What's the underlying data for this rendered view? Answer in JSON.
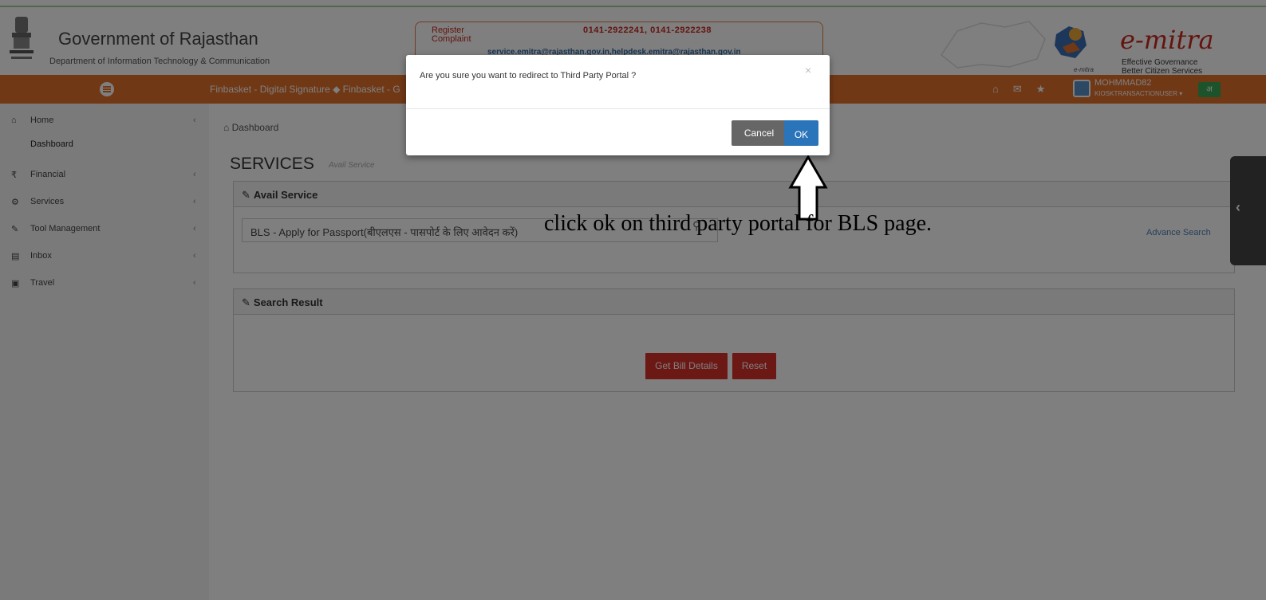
{
  "header": {
    "gov_title": "Government of Rajasthan",
    "dept_title": "Department of Information Technology & Communication",
    "register_complaint": "Register Complaint",
    "phones": "0141-2922241, 0141-2922238",
    "emails": "service.emitra@rajasthan.gov.in,helpdesk.emitra@rajasthan.gov.in",
    "brand": "e-mitra",
    "brand_small": "e-mitra",
    "tagline_1": "Effective Governance",
    "tagline_2": "Better Citizen Services"
  },
  "navbar": {
    "ticker": "Finbasket - Digital Signature ◆ Finbasket - G",
    "user_name": "MOHMMAD82",
    "user_role": "KIOSKTRANSACTIONUSER ▾",
    "lang": "अ"
  },
  "sidebar": {
    "items": [
      {
        "icon": "⌂",
        "label": "Home"
      },
      {
        "icon": "₹",
        "label": "Financial"
      },
      {
        "icon": "⚙",
        "label": "Services"
      },
      {
        "icon": "✎",
        "label": "Tool Management"
      },
      {
        "icon": "▤",
        "label": "Inbox"
      },
      {
        "icon": "▣",
        "label": "Travel"
      }
    ],
    "sub_dashboard": "Dashboard"
  },
  "main": {
    "breadcrumb": "Dashboard",
    "title": "SERVICES",
    "subtitle": "Avail Service",
    "avail_panel_title": "Avail Service",
    "service_value": "BLS - Apply for Passport(बीएलएस - पासपोर्ट के लिए आवेदन करें)",
    "advance_search": "Advance Search",
    "result_panel_title": "Search Result",
    "get_bill_label": "Get Bill Details",
    "reset_label": "Reset"
  },
  "modal": {
    "message": "Are you sure you want to redirect to Third Party Portal ?",
    "close": "×",
    "cancel_label": "Cancel",
    "ok_label": "OK"
  },
  "annotation": {
    "text": "click ok on third party portal for BLS page."
  },
  "colors": {
    "navbar": "#e3712c",
    "ok_button": "#2a74b9",
    "red_button": "#d9302a",
    "brand_red": "#c8281e"
  }
}
